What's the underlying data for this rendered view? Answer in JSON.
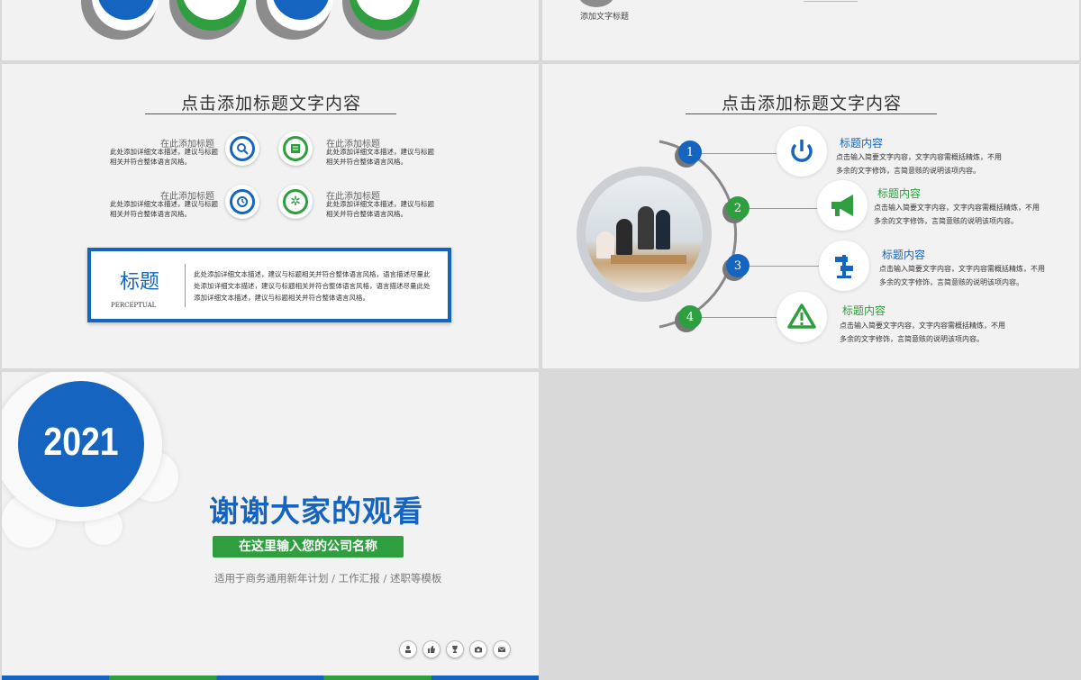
{
  "slide1": {},
  "slide2": {
    "caption": "添加文字标题"
  },
  "slide3": {
    "title": "点击添加标题文字内容",
    "items": [
      {
        "title": "在此添加标题",
        "desc": "此处添加详细文本描述，建议与标题相关并符合整体语言风格。",
        "icon": "search-icon",
        "color": "#1565c0"
      },
      {
        "title": "在此添加标题",
        "desc": "此处添加详细文本描述，建议与标题相关并符合整体语言风格。",
        "icon": "document-icon",
        "color": "#2e9e3e"
      },
      {
        "title": "在此添加标题",
        "desc": "此处添加详细文本描述，建议与标题相关并符合整体语言风格。",
        "icon": "clock-icon",
        "color": "#1565c0"
      },
      {
        "title": "在此添加标题",
        "desc": "此处添加详细文本描述，建议与标题相关并符合整体语言风格。",
        "icon": "gear-icon",
        "color": "#2e9e3e"
      }
    ],
    "box": {
      "title": "标题",
      "subtitle": "PERCEPTUAL",
      "desc": "此处添加详细文本描述，建议与标题相关并符合整体语言风格，语言描述尽量此处添加详细文本描述，建议与标题相关并符合整体语言风格，语言描述尽量此处添加详细文本描述，建议与标题相关并符合整体语言风格。"
    }
  },
  "slide4": {
    "title": "点击添加标题文字内容",
    "items": [
      {
        "num": "1",
        "title": "标题内容",
        "desc": "点击输入简要文字内容，文字内容需概括精炼，不用多余的文字修饰，言简意赅的说明该项内容。",
        "icon": "power-icon",
        "color": "#1565c0"
      },
      {
        "num": "2",
        "title": "标题内容",
        "desc": "点击输入简要文字内容，文字内容需概括精炼，不用多余的文字修饰，言简意赅的说明该项内容。",
        "icon": "megaphone-icon",
        "color": "#2e9e3e"
      },
      {
        "num": "3",
        "title": "标题内容",
        "desc": "点击输入简要文字内容，文字内容需概括精炼，不用多余的文字修饰，言简意赅的说明该项内容。",
        "icon": "signpost-icon",
        "color": "#1565c0"
      },
      {
        "num": "4",
        "title": "标题内容",
        "desc": "点击输入简要文字内容，文字内容需概括精炼，不用多余的文字修饰，言简意赅的说明该项内容。",
        "icon": "warning-icon",
        "color": "#2e9e3e"
      }
    ]
  },
  "slide5": {
    "year": "2021",
    "thanks": "谢谢大家的观看",
    "company": "在这里输入您的公司名称",
    "subtitle": "适用于商务通用新年计划 / 工作汇报 / 述职等模板",
    "social_icons": [
      "person-icon",
      "thumbs-up-icon",
      "trophy-icon",
      "camera-icon",
      "mail-icon"
    ]
  },
  "colors": {
    "blue": "#1565c0",
    "green": "#2e9e3e",
    "slide_bg": "#f2f2f2",
    "page_bg": "#d9d9d9"
  }
}
